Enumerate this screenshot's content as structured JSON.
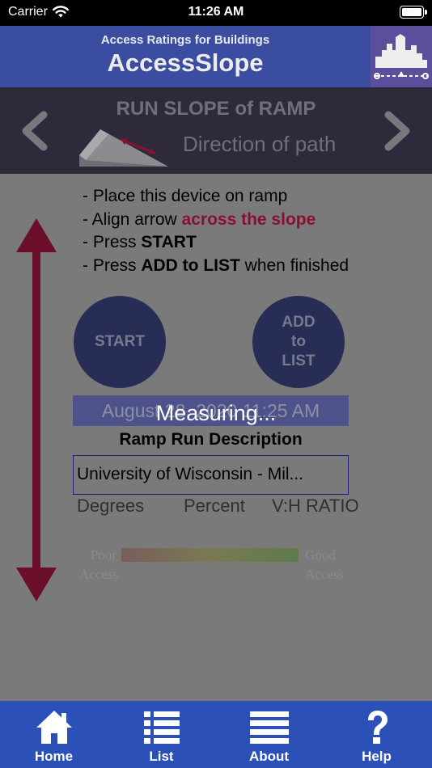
{
  "status_bar": {
    "carrier": "Carrier",
    "time": "11:26 AM"
  },
  "header": {
    "subtitle": "Access Ratings for Buildings",
    "title": "AccessSlope"
  },
  "measurement": {
    "title": "RUN SLOPE of RAMP",
    "direction": "Direction of path"
  },
  "instructions": {
    "line1": "- Place this device on ramp",
    "line2_prefix": "- Align arrow ",
    "line2_highlight": "across the slope",
    "line3_prefix": "- Press ",
    "line3_bold": "START",
    "line4_prefix": "- Press ",
    "line4_bold": "ADD to LIST",
    "line4_suffix": " when finished"
  },
  "buttons": {
    "start": "START",
    "add_to_list": "ADD\nto\nLIST"
  },
  "date": "August 28, 2020 11:25 AM",
  "description": {
    "label": "Ramp Run Description",
    "value": "University of Wisconsin - Mil..."
  },
  "metrics": {
    "degrees": "Degrees",
    "percent": "Percent",
    "ratio": "V:H RATIO"
  },
  "gauge": {
    "poor": "Poor\nAccess",
    "good": "Good\nAccess"
  },
  "overlay": "Measuring...",
  "tabs": [
    {
      "label": "Home",
      "icon": "home-icon"
    },
    {
      "label": "List",
      "icon": "list-icon"
    },
    {
      "label": "About",
      "icon": "menu-icon"
    },
    {
      "label": "Help",
      "icon": "question-icon"
    }
  ],
  "colors": {
    "header": "#3a4da0",
    "tabbar": "#2b50b8",
    "arrow": "#6a0e2a",
    "button": "#272d55"
  }
}
